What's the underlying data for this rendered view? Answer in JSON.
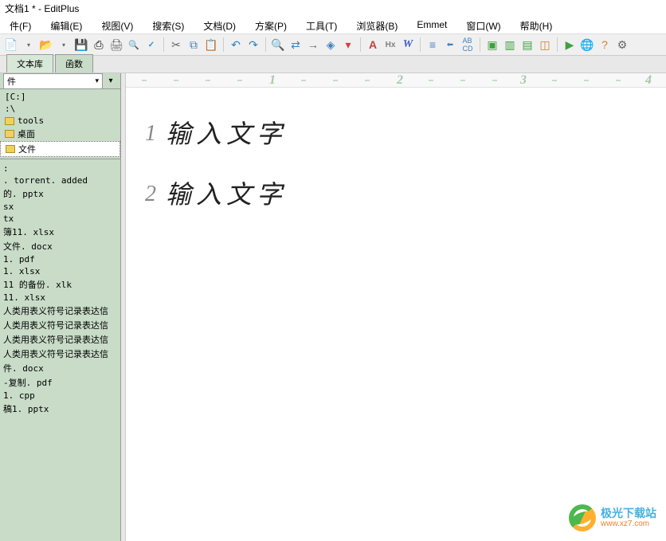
{
  "title": "文档1 * - EditPlus",
  "menu": {
    "file": "件(F)",
    "edit": "编辑(E)",
    "view": "视图(V)",
    "search": "搜索(S)",
    "document": "文档(D)",
    "project": "方案(P)",
    "tools": "工具(T)",
    "browser": "浏览器(B)",
    "emmet": "Emmet",
    "window": "窗口(W)",
    "help": "帮助(H)"
  },
  "tabs": {
    "text_lib": "文本库",
    "functions": "函数"
  },
  "sidebar": {
    "dropdown": "件",
    "dirs": [
      "[C:]",
      ":\\",
      "tools",
      "桌面",
      "文件"
    ],
    "files": [
      ":",
      ". torrent. added",
      "的. pptx",
      "sx",
      "tx",
      "簿11. xlsx",
      "文件. docx",
      "1. pdf",
      "1. xlsx",
      "11 的备份. xlk",
      "11. xlsx",
      "人类用表义符号记录表达信",
      "人类用表义符号记录表达信",
      "人类用表义符号记录表达信",
      "人类用表义符号记录表达信",
      "件. docx",
      "-复制. pdf",
      "1. cpp",
      "稿1. pptx"
    ]
  },
  "ruler": [
    "1",
    "2",
    "3",
    "4"
  ],
  "editor": {
    "lines": [
      {
        "num": "1",
        "text": "输入文字"
      },
      {
        "num": "2",
        "text": "输入文字"
      }
    ]
  },
  "watermark": {
    "title": "极光下载站",
    "url": "www.xz7.com"
  }
}
